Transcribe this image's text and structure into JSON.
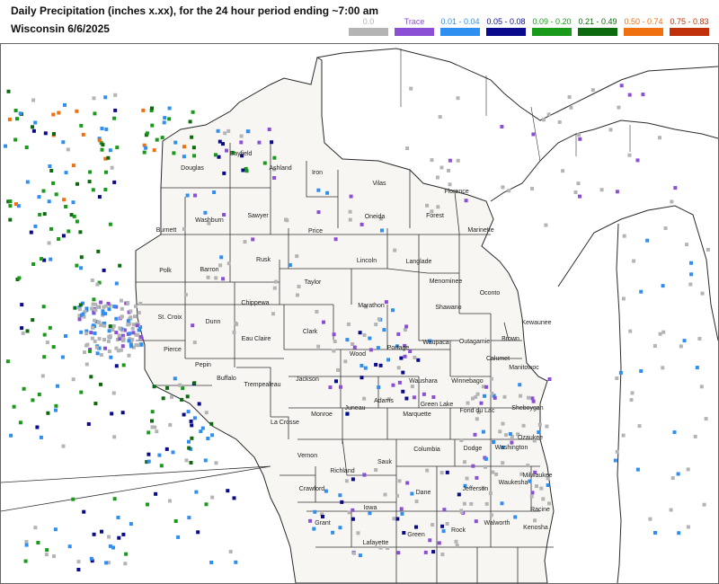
{
  "title": "Daily Precipitation (inches  x.xx),  for the 24 hour period ending ~7:00 am",
  "subtitle": "Wisconsin 6/6/2025",
  "legend": [
    {
      "label": "0.0",
      "color": "#b4b4b4"
    },
    {
      "label": "Trace",
      "color": "#8a4fd4"
    },
    {
      "label": "0.01 - 0.04",
      "color": "#2e8ff0"
    },
    {
      "label": "0.05 - 0.08",
      "color": "#0a0a8c"
    },
    {
      "label": "0.09 - 0.20",
      "color": "#1a9a1a"
    },
    {
      "label": "0.21 - 0.49",
      "color": "#0e6a0e"
    },
    {
      "label": "0.50 - 0.74",
      "color": "#f07010"
    },
    {
      "label": "0.75 - 0.83",
      "color": "#c0300a"
    }
  ],
  "counties": [
    "Douglas",
    "Bayfield",
    "Ashland",
    "Iron",
    "Vilas",
    "Florence",
    "Burnett",
    "Washburn",
    "Sawyer",
    "Price",
    "Oneida",
    "Forest",
    "Marinette",
    "Polk",
    "Barron",
    "Rusk",
    "Lincoln",
    "Langlade",
    "Taylor",
    "Menominee",
    "Oconto",
    "St. Croix",
    "Dunn",
    "Chippewa",
    "Marathon",
    "Shawano",
    "Clark",
    "Eau Claire",
    "Kewaunee",
    "Pierce",
    "Pepin",
    "Buffalo",
    "Trempealeau",
    "Jackson",
    "Wood",
    "Portage",
    "Waupaca",
    "Outagamie",
    "Brown",
    "Calumet",
    "Manitowoc",
    "Waushara",
    "Winnebago",
    "Monroe",
    "Juneau",
    "Adams",
    "Green Lake",
    "Fond du Lac",
    "Sheboygan",
    "La Crosse",
    "Vernon",
    "Marquette",
    "Richland",
    "Sauk",
    "Columbia",
    "Dodge",
    "Washington",
    "Ozaukee",
    "Crawford",
    "Dane",
    "Jefferson",
    "Waukesha",
    "Milwaukee",
    "Grant",
    "Iowa",
    "Racine",
    "Lafayette",
    "Green",
    "Rock",
    "Walworth",
    "Kenosha"
  ]
}
